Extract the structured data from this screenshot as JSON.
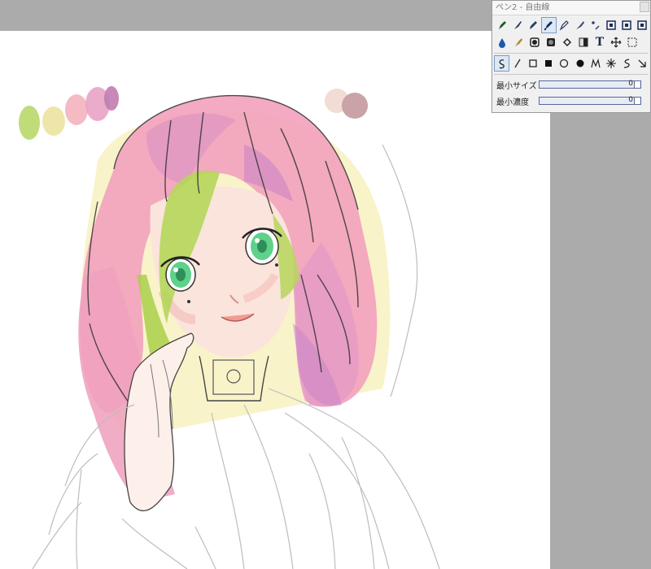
{
  "panel": {
    "title": "ペン2 - 自由線",
    "tools_row1": [
      "pen-icon",
      "brush-icon",
      "pencil-icon",
      "airbrush-icon",
      "marker-icon",
      "watercolor-icon",
      "blur-icon",
      "layer-square-icon",
      "layer-square-icon",
      "layer-square-icon"
    ],
    "tools_row2": [
      "droplet-icon",
      "smudge-icon",
      "dodge-icon",
      "burn-icon",
      "fill-icon",
      "gradient-icon",
      "text-icon",
      "move-icon",
      "select-icon"
    ],
    "text_tool_glyph": "T",
    "sliders": [
      {
        "label": "最小サイズ",
        "value": "0"
      },
      {
        "label": "最小濃度",
        "value": "0"
      }
    ]
  },
  "colors": {
    "panel_bg": "#f0f0f0",
    "workspace_bg": "#ababab",
    "hair_pink": "#f2a3bd",
    "hair_green": "#b5d65a",
    "eye_green": "#5fd18a",
    "swatch_1": "#b8d86a",
    "swatch_2": "#ece3a0",
    "swatch_3": "#f3b4bf",
    "swatch_4": "#e9a3c6",
    "swatch_5": "#c07cb0",
    "swatch_6": "#f1ddd5",
    "swatch_7": "#c9a3a6"
  }
}
